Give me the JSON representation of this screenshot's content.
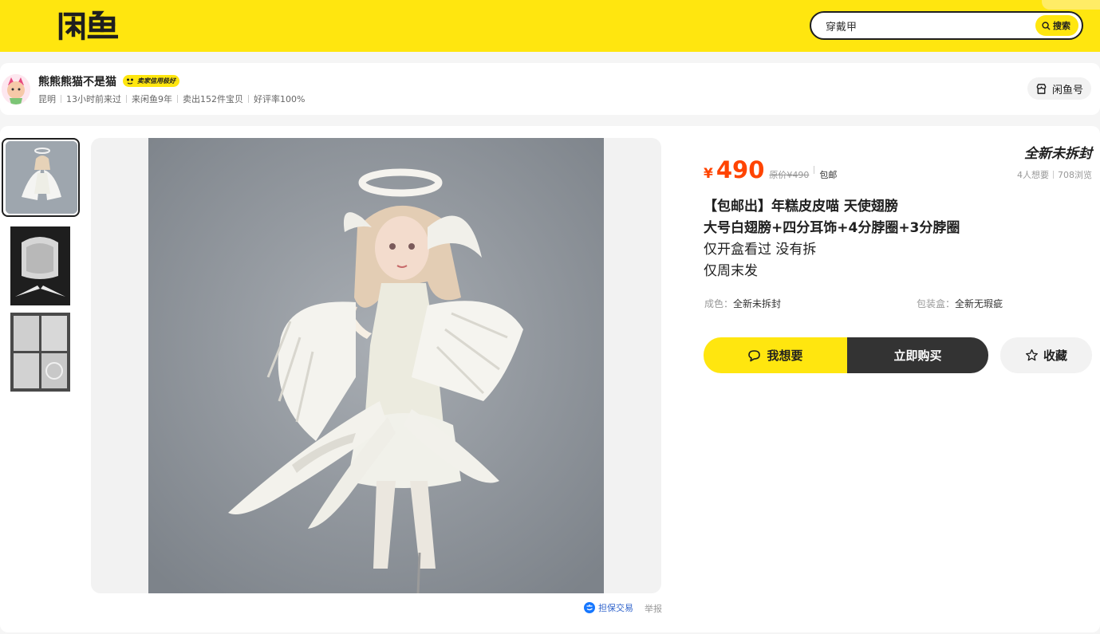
{
  "header": {
    "logo_text": "闲鱼",
    "search": {
      "value": "穿戴甲",
      "button_label": "搜索"
    },
    "colors": {
      "brand": "#ffe60f"
    }
  },
  "seller": {
    "name": "熊熊熊猫不是猫",
    "credit_badge": "卖家信用极好",
    "meta": [
      "昆明",
      "13小时前来过",
      "来闲鱼9年",
      "卖出152件宝贝",
      "好评率100%"
    ],
    "profile_button": "闲鱼号"
  },
  "gallery": {
    "thumbnails": [
      "thumb-1",
      "thumb-2",
      "thumb-3"
    ],
    "active_index": 0,
    "guarantee_label": "担保交易",
    "report_label": "举报"
  },
  "item": {
    "currency": "¥",
    "price": "490",
    "original_price": "原价¥490",
    "shipping": "包邮",
    "condition_tag": "全新未拆封",
    "wants": "4人想要",
    "views": "708浏览",
    "description": [
      "【包邮出】年糕皮皮喵 天使翅膀",
      "大号白翅膀+四分耳饰+4分脖圈+3分脖圈",
      "仅开盒看过 没有拆",
      "仅周末发"
    ],
    "attributes": [
      {
        "key": "成色：",
        "value": "全新未拆封"
      },
      {
        "key": "包装盒：",
        "value": "全新无瑕疵"
      }
    ],
    "colors": {
      "price": "#ff4400",
      "buy_button": "#333333"
    }
  },
  "actions": {
    "want_label": "我想要",
    "buy_label": "立即购买",
    "favorite_label": "收藏"
  }
}
